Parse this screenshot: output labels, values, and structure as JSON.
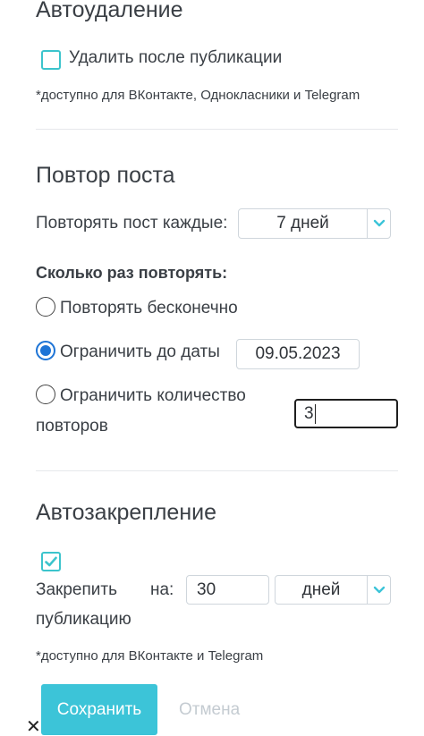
{
  "autodelete": {
    "title": "Автоудаление",
    "checkbox_label": "Удалить после публикации",
    "checked": false,
    "note": "*доступно для ВКонтакте, Однокласники и Telegram"
  },
  "repeat": {
    "title": "Повтор поста",
    "every_label": "Повторять пост каждые:",
    "every_value": "7 дней",
    "how_many_label": "Сколько раз повторять:",
    "option_infinite": "Повторять бесконечно",
    "option_until_date": "Ограничить до даты",
    "date_value": "09.05.2023",
    "option_count_line1": "Ограничить количество",
    "option_count_line2": "повторов",
    "count_value": "3",
    "selected_option": "until_date"
  },
  "pin": {
    "title": "Автозакрепление",
    "checked": true,
    "label_line1": "Закрепить",
    "label_on": "на:",
    "label_line2": "публикацию",
    "amount_value": "30",
    "unit_value": "дней",
    "note": "*доступно для ВКонтакте и Telegram"
  },
  "actions": {
    "save": "Сохранить",
    "cancel": "Отмена",
    "close_glyph": "✕"
  },
  "colors": {
    "accent": "#3cc4d8",
    "radio_selected": "#1d74d6",
    "text": "#3a3f45"
  }
}
